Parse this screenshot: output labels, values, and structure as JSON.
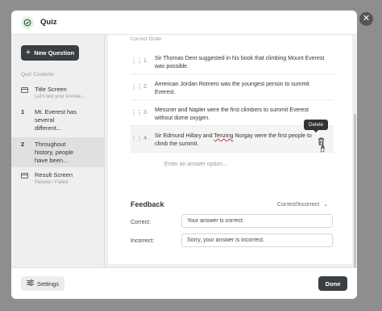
{
  "app": {
    "title": "Quiz"
  },
  "sidebar": {
    "new_question_label": "New Question",
    "section_label": "Quiz Contents",
    "items": [
      {
        "title": "Title Screen",
        "subtitle": "Let's test your knowle..."
      },
      {
        "number": "1",
        "title": "Mt. Everest has several different..."
      },
      {
        "number": "2",
        "title": "Throughout history, people have been..."
      },
      {
        "title": "Result Screen",
        "subtitle": "Passed / Failed"
      }
    ]
  },
  "answers": {
    "section_label": "Correct Order",
    "items": [
      {
        "number": "1.",
        "text": "Sir Thomas Dent suggested in his book that climbing Mount Everest was possible."
      },
      {
        "number": "2.",
        "text": "American Jordan Romero was the youngest person to summit Everest."
      },
      {
        "number": "3.",
        "text": "Messner and Napler were the first climbers to summit Everest without dome oxygen."
      },
      {
        "number": "4.",
        "text_before": "Sir Edmund Hillary and ",
        "text_underlined": "Tenzing",
        "text_after": " Norgay were the first people to climb the summit."
      }
    ],
    "tooltip": "Delete",
    "placeholder": "Enter an answer option..."
  },
  "feedback": {
    "title": "Feedback",
    "mode": "Correct/Incorrect",
    "correct_label": "Correct:",
    "correct_value": "Your answer is correct.",
    "incorrect_label": "Incorrect:",
    "incorrect_value": "Sorry, your answer is incorrect."
  },
  "footer": {
    "settings_label": "Settings",
    "done_label": "Done"
  },
  "colors": {
    "primary_button": "#3a3f45",
    "overlay": "#8e8e8e",
    "logo_bg": "#e6f1e6"
  }
}
